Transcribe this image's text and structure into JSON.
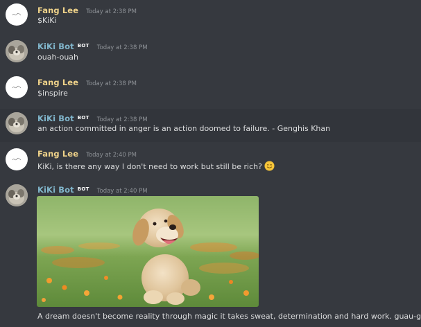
{
  "messages": [
    {
      "author": "Fang Lee",
      "is_bot": false,
      "time": "Today at 2:38 PM",
      "text": "$KiKi"
    },
    {
      "author": "KiKi Bot",
      "is_bot": true,
      "badge": "BOT",
      "time": "Today at 2:38 PM",
      "text": "ouah-ouah"
    },
    {
      "author": "Fang Lee",
      "is_bot": false,
      "time": "Today at 2:38 PM",
      "text": "$inspire"
    },
    {
      "author": "KiKi Bot",
      "is_bot": true,
      "badge": "BOT",
      "time": "Today at 2:38 PM",
      "text": "an action committed in anger is an action doomed to failure.  - Genghis Khan"
    },
    {
      "author": "Fang Lee",
      "is_bot": false,
      "time": "Today at 2:40 PM",
      "text": "KiKi, is there any way I don't need to work but still be rich?",
      "emoji": "slightly-smiling-face"
    },
    {
      "author": "KiKi Bot",
      "is_bot": true,
      "badge": "BOT",
      "time": "Today at 2:40 PM",
      "attachment": "golden-retriever-puppy-photo",
      "text": "A dream doesn't become reality through magic it takes sweat, determination and hard work. guau-guau"
    }
  ],
  "colors": {
    "background": "#36393f",
    "user_name": "#f0d38a",
    "bot_name": "#81b6cc",
    "timestamp": "#8e9297",
    "message_text": "#dcddde"
  }
}
